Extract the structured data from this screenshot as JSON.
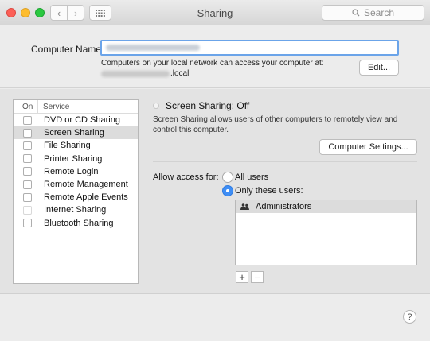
{
  "window": {
    "title": "Sharing"
  },
  "toolbar": {
    "search_placeholder": "Search"
  },
  "computer_name": {
    "label": "Computer Name:",
    "access_text": "Computers on your local network can access your computer at:",
    "host_suffix": ".local",
    "edit_label": "Edit..."
  },
  "services": {
    "col_on": "On",
    "col_service": "Service",
    "items": [
      {
        "label": "DVD or CD Sharing",
        "selected": false
      },
      {
        "label": "Screen Sharing",
        "selected": true
      },
      {
        "label": "File Sharing",
        "selected": false
      },
      {
        "label": "Printer Sharing",
        "selected": false
      },
      {
        "label": "Remote Login",
        "selected": false
      },
      {
        "label": "Remote Management",
        "selected": false
      },
      {
        "label": "Remote Apple Events",
        "selected": false
      },
      {
        "label": "Internet Sharing",
        "selected": false
      },
      {
        "label": "Bluetooth Sharing",
        "selected": false
      }
    ]
  },
  "detail": {
    "status": "Screen Sharing: Off",
    "description": "Screen Sharing allows users of other computers to remotely view and control this computer.",
    "computer_settings_label": "Computer Settings...",
    "allow_label": "Allow access for:",
    "option_all": "All users",
    "option_only": "Only these users:",
    "selected_option": "Only these users:",
    "users": [
      "Administrators"
    ],
    "add_label": "+",
    "remove_label": "−"
  },
  "help": {
    "label": "?"
  }
}
